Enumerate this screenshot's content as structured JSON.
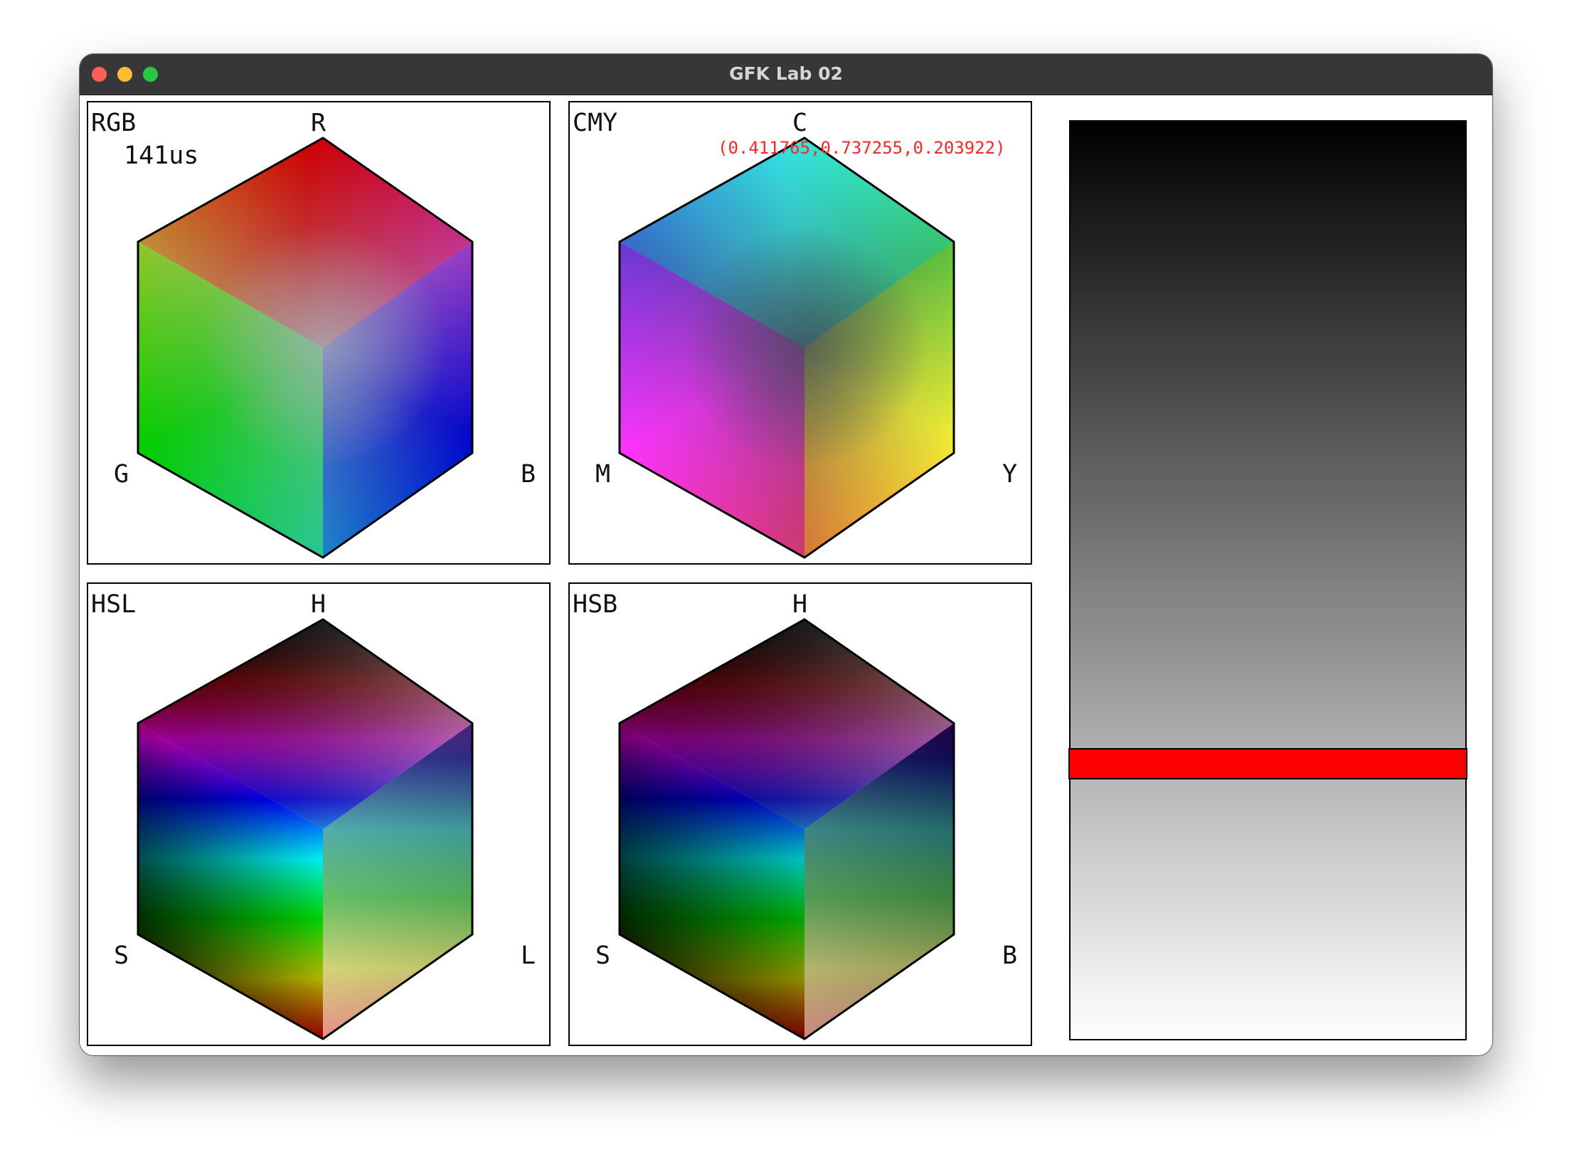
{
  "window": {
    "title": "GFK Lab 02",
    "controls": [
      "close",
      "minimize",
      "zoom"
    ]
  },
  "panels": [
    {
      "id": "rgb",
      "model": "RGB",
      "top": "R",
      "left": "G",
      "right": "B",
      "colors": {
        "top": "#cc0000",
        "left": "#00cc00",
        "right": "#0000cc",
        "tl": "#cccc00",
        "tr": "#cc00cc",
        "bottom": "#00cccc",
        "center": "#a8b4ba"
      }
    },
    {
      "id": "cmy",
      "model": "CMY",
      "top": "C",
      "left": "M",
      "right": "Y",
      "colors": {
        "top": "#33e6e6",
        "left": "#ff33ff",
        "right": "#f2f233",
        "tl": "#3333ff",
        "tr": "#33ff33",
        "bottom": "#ff3333",
        "center": "#404855"
      }
    },
    {
      "id": "hsl",
      "model": "HSL",
      "top": "H",
      "left": "S",
      "right": "L",
      "hue_stops": [
        "#ff0000",
        "#ff00ff",
        "#0000ff",
        "#00ffff",
        "#00ff00",
        "#ffff00",
        "#ff0000"
      ],
      "right_face": {
        "top": "#333333",
        "bottom": "#d9d9d9"
      }
    },
    {
      "id": "hsb",
      "model": "HSB",
      "top": "H",
      "left": "S",
      "right": "B",
      "hue_stops": [
        "#cc0000",
        "#cc00cc",
        "#0000cc",
        "#00cccc",
        "#00cc00",
        "#cccc00",
        "#cc0000"
      ],
      "right_face": {
        "top": "#000000",
        "bottom": "#cccccc"
      }
    }
  ],
  "overlays": {
    "timing": "141us",
    "picked_value": "(0.411765,0.737255,0.203922)"
  },
  "slider": {
    "value": 0.7,
    "gradient": [
      "#000000",
      "#ffffff"
    ],
    "thumb_color": "#ff0000"
  }
}
